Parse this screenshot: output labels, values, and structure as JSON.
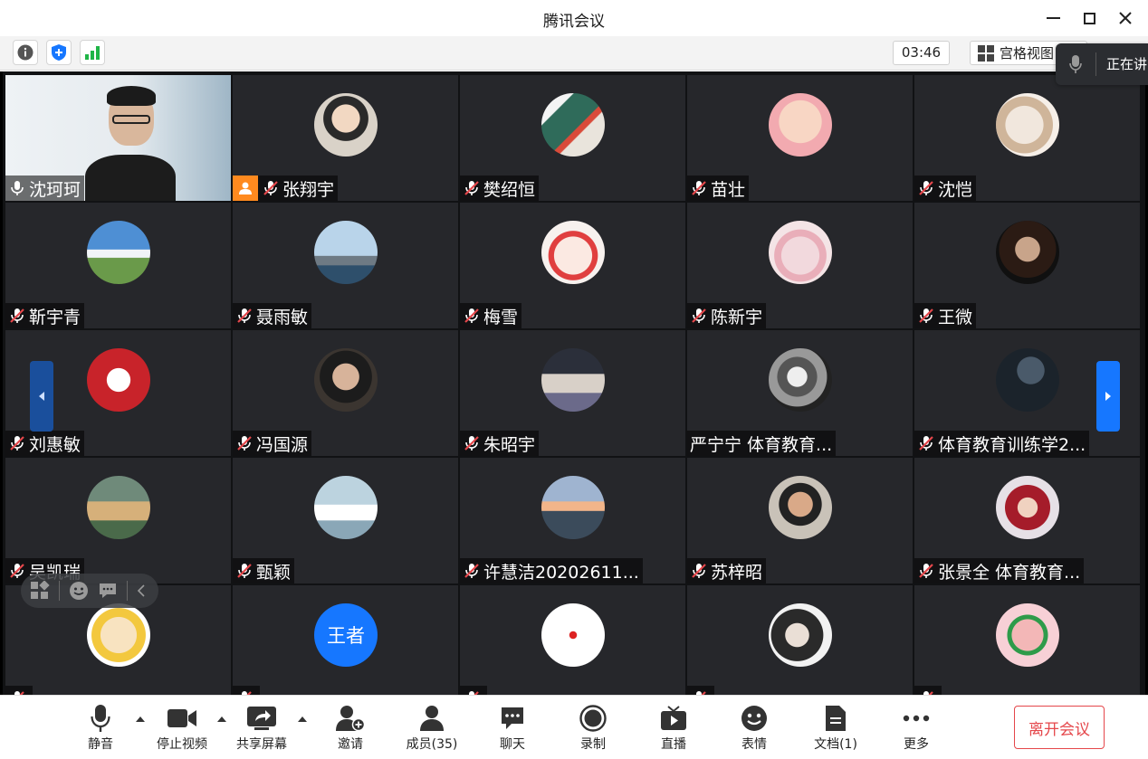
{
  "window": {
    "title": "腾讯会议"
  },
  "infobar": {
    "timer": "03:46",
    "view_label": "宫格视图",
    "speaking_label": "正在讲"
  },
  "participants": [
    {
      "name": "沈珂珂",
      "mic": "on",
      "video": true
    },
    {
      "name": "张翔宇",
      "mic": "off",
      "host": true
    },
    {
      "name": "樊绍恒",
      "mic": "off"
    },
    {
      "name": "苗壮",
      "mic": "off"
    },
    {
      "name": "沈恺",
      "mic": "off"
    },
    {
      "name": "靳宇青",
      "mic": "off"
    },
    {
      "name": "聂雨敏",
      "mic": "off"
    },
    {
      "name": "梅雪",
      "mic": "off"
    },
    {
      "name": "陈新宇",
      "mic": "off"
    },
    {
      "name": "王微",
      "mic": "off"
    },
    {
      "name": "刘惠敏",
      "mic": "off"
    },
    {
      "name": "冯国源",
      "mic": "off"
    },
    {
      "name": "朱昭宇",
      "mic": "off"
    },
    {
      "name": "严宁宁 体育教育...",
      "mic": "none"
    },
    {
      "name": "体育教育训练学2...",
      "mic": "off"
    },
    {
      "name": "吴凯瑞",
      "mic": "off"
    },
    {
      "name": "甄颖",
      "mic": "off"
    },
    {
      "name": "许慧洁20202611...",
      "mic": "off"
    },
    {
      "name": "苏梓昭",
      "mic": "off"
    },
    {
      "name": "张景全 体育教育...",
      "mic": "off"
    },
    {
      "name": "",
      "mic": "off"
    },
    {
      "name": "",
      "mic": "off",
      "avatar_text": "王者"
    },
    {
      "name": "",
      "mic": "off"
    },
    {
      "name": "",
      "mic": "off"
    },
    {
      "name": "",
      "mic": "off"
    }
  ],
  "toolbar": {
    "mute": "静音",
    "stop_video": "停止视频",
    "share_screen": "共享屏幕",
    "invite": "邀请",
    "members": "成员(35)",
    "chat": "聊天",
    "record": "录制",
    "live": "直播",
    "emoji": "表情",
    "docs": "文档(1)",
    "more": "更多",
    "leave": "离开会议"
  },
  "colors": {
    "accent": "#1677ff",
    "leave": "#e5474b",
    "host_badge": "#ff8a1f",
    "tile_bg": "#26272b"
  }
}
